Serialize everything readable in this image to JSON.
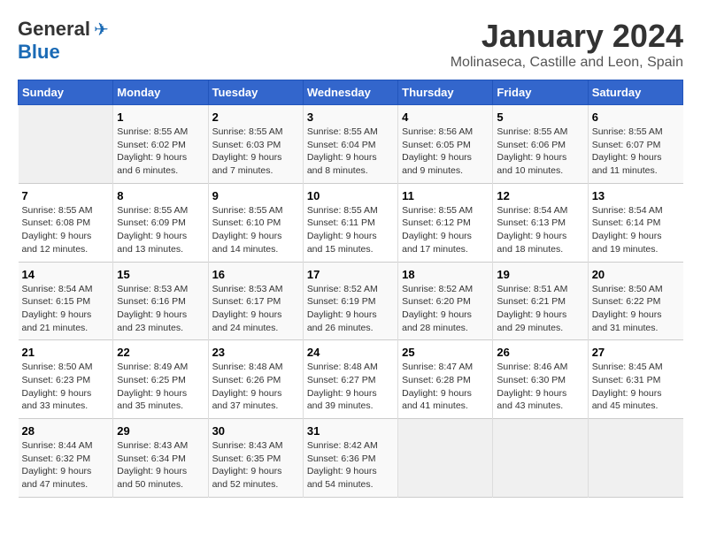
{
  "logo": {
    "general": "General",
    "blue": "Blue"
  },
  "title": "January 2024",
  "subtitle": "Molinaseca, Castille and Leon, Spain",
  "days": [
    "Sunday",
    "Monday",
    "Tuesday",
    "Wednesday",
    "Thursday",
    "Friday",
    "Saturday"
  ],
  "weeks": [
    [
      null,
      {
        "day": 1,
        "sunrise": "Sunrise: 8:55 AM",
        "sunset": "Sunset: 6:02 PM",
        "daylight": "Daylight: 9 hours and 6 minutes."
      },
      {
        "day": 2,
        "sunrise": "Sunrise: 8:55 AM",
        "sunset": "Sunset: 6:03 PM",
        "daylight": "Daylight: 9 hours and 7 minutes."
      },
      {
        "day": 3,
        "sunrise": "Sunrise: 8:55 AM",
        "sunset": "Sunset: 6:04 PM",
        "daylight": "Daylight: 9 hours and 8 minutes."
      },
      {
        "day": 4,
        "sunrise": "Sunrise: 8:56 AM",
        "sunset": "Sunset: 6:05 PM",
        "daylight": "Daylight: 9 hours and 9 minutes."
      },
      {
        "day": 5,
        "sunrise": "Sunrise: 8:55 AM",
        "sunset": "Sunset: 6:06 PM",
        "daylight": "Daylight: 9 hours and 10 minutes."
      },
      {
        "day": 6,
        "sunrise": "Sunrise: 8:55 AM",
        "sunset": "Sunset: 6:07 PM",
        "daylight": "Daylight: 9 hours and 11 minutes."
      }
    ],
    [
      {
        "day": 7,
        "sunrise": "Sunrise: 8:55 AM",
        "sunset": "Sunset: 6:08 PM",
        "daylight": "Daylight: 9 hours and 12 minutes."
      },
      {
        "day": 8,
        "sunrise": "Sunrise: 8:55 AM",
        "sunset": "Sunset: 6:09 PM",
        "daylight": "Daylight: 9 hours and 13 minutes."
      },
      {
        "day": 9,
        "sunrise": "Sunrise: 8:55 AM",
        "sunset": "Sunset: 6:10 PM",
        "daylight": "Daylight: 9 hours and 14 minutes."
      },
      {
        "day": 10,
        "sunrise": "Sunrise: 8:55 AM",
        "sunset": "Sunset: 6:11 PM",
        "daylight": "Daylight: 9 hours and 15 minutes."
      },
      {
        "day": 11,
        "sunrise": "Sunrise: 8:55 AM",
        "sunset": "Sunset: 6:12 PM",
        "daylight": "Daylight: 9 hours and 17 minutes."
      },
      {
        "day": 12,
        "sunrise": "Sunrise: 8:54 AM",
        "sunset": "Sunset: 6:13 PM",
        "daylight": "Daylight: 9 hours and 18 minutes."
      },
      {
        "day": 13,
        "sunrise": "Sunrise: 8:54 AM",
        "sunset": "Sunset: 6:14 PM",
        "daylight": "Daylight: 9 hours and 19 minutes."
      }
    ],
    [
      {
        "day": 14,
        "sunrise": "Sunrise: 8:54 AM",
        "sunset": "Sunset: 6:15 PM",
        "daylight": "Daylight: 9 hours and 21 minutes."
      },
      {
        "day": 15,
        "sunrise": "Sunrise: 8:53 AM",
        "sunset": "Sunset: 6:16 PM",
        "daylight": "Daylight: 9 hours and 23 minutes."
      },
      {
        "day": 16,
        "sunrise": "Sunrise: 8:53 AM",
        "sunset": "Sunset: 6:17 PM",
        "daylight": "Daylight: 9 hours and 24 minutes."
      },
      {
        "day": 17,
        "sunrise": "Sunrise: 8:52 AM",
        "sunset": "Sunset: 6:19 PM",
        "daylight": "Daylight: 9 hours and 26 minutes."
      },
      {
        "day": 18,
        "sunrise": "Sunrise: 8:52 AM",
        "sunset": "Sunset: 6:20 PM",
        "daylight": "Daylight: 9 hours and 28 minutes."
      },
      {
        "day": 19,
        "sunrise": "Sunrise: 8:51 AM",
        "sunset": "Sunset: 6:21 PM",
        "daylight": "Daylight: 9 hours and 29 minutes."
      },
      {
        "day": 20,
        "sunrise": "Sunrise: 8:50 AM",
        "sunset": "Sunset: 6:22 PM",
        "daylight": "Daylight: 9 hours and 31 minutes."
      }
    ],
    [
      {
        "day": 21,
        "sunrise": "Sunrise: 8:50 AM",
        "sunset": "Sunset: 6:23 PM",
        "daylight": "Daylight: 9 hours and 33 minutes."
      },
      {
        "day": 22,
        "sunrise": "Sunrise: 8:49 AM",
        "sunset": "Sunset: 6:25 PM",
        "daylight": "Daylight: 9 hours and 35 minutes."
      },
      {
        "day": 23,
        "sunrise": "Sunrise: 8:48 AM",
        "sunset": "Sunset: 6:26 PM",
        "daylight": "Daylight: 9 hours and 37 minutes."
      },
      {
        "day": 24,
        "sunrise": "Sunrise: 8:48 AM",
        "sunset": "Sunset: 6:27 PM",
        "daylight": "Daylight: 9 hours and 39 minutes."
      },
      {
        "day": 25,
        "sunrise": "Sunrise: 8:47 AM",
        "sunset": "Sunset: 6:28 PM",
        "daylight": "Daylight: 9 hours and 41 minutes."
      },
      {
        "day": 26,
        "sunrise": "Sunrise: 8:46 AM",
        "sunset": "Sunset: 6:30 PM",
        "daylight": "Daylight: 9 hours and 43 minutes."
      },
      {
        "day": 27,
        "sunrise": "Sunrise: 8:45 AM",
        "sunset": "Sunset: 6:31 PM",
        "daylight": "Daylight: 9 hours and 45 minutes."
      }
    ],
    [
      {
        "day": 28,
        "sunrise": "Sunrise: 8:44 AM",
        "sunset": "Sunset: 6:32 PM",
        "daylight": "Daylight: 9 hours and 47 minutes."
      },
      {
        "day": 29,
        "sunrise": "Sunrise: 8:43 AM",
        "sunset": "Sunset: 6:34 PM",
        "daylight": "Daylight: 9 hours and 50 minutes."
      },
      {
        "day": 30,
        "sunrise": "Sunrise: 8:43 AM",
        "sunset": "Sunset: 6:35 PM",
        "daylight": "Daylight: 9 hours and 52 minutes."
      },
      {
        "day": 31,
        "sunrise": "Sunrise: 8:42 AM",
        "sunset": "Sunset: 6:36 PM",
        "daylight": "Daylight: 9 hours and 54 minutes."
      },
      null,
      null,
      null
    ]
  ]
}
